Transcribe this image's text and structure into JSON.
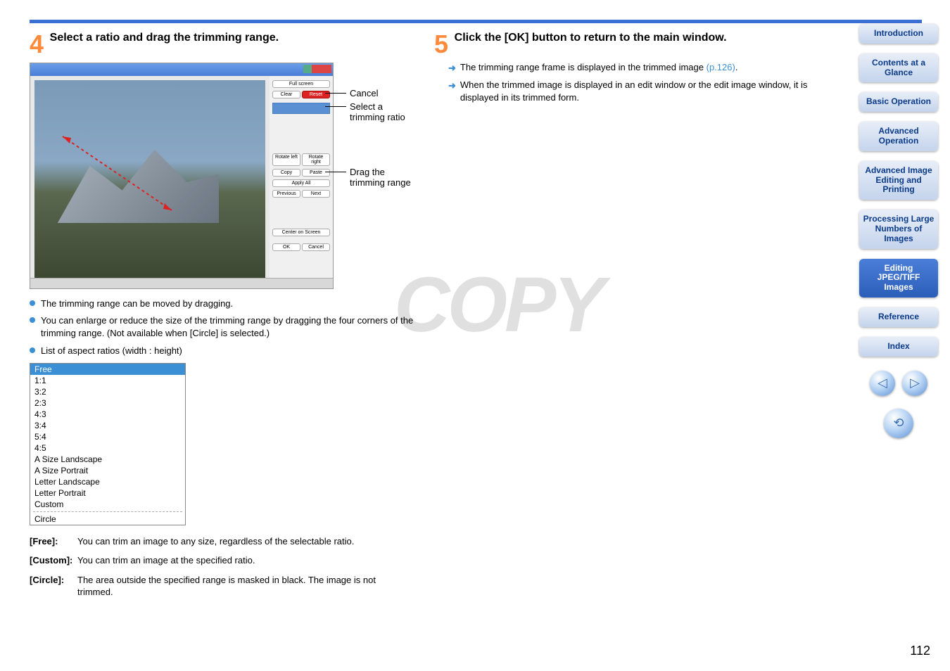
{
  "step4": {
    "num": "4",
    "title": "Select a ratio and drag the trimming range.",
    "callout_cancel": "Cancel",
    "callout_select": "Select a trimming ratio",
    "callout_drag": "Drag the trimming range",
    "b1": "The trimming range can be moved by dragging.",
    "b2": "You can enlarge or reduce the size of the trimming range by dragging the four corners of the trimming range. (Not available when [Circle] is selected.)",
    "b3": "List of aspect ratios (width : height)",
    "btn_full": "Full screen",
    "btn_clear": "Clear",
    "btn_reset": "Reset",
    "btn_rl": "Rotate left",
    "btn_rr": "Rotate right",
    "btn_copy": "Copy",
    "btn_paste": "Paste",
    "btn_apply": "Apply All",
    "btn_prev": "Previous",
    "btn_next": "Next",
    "btn_center": "Center on Screen",
    "btn_ok": "OK",
    "btn_cancel": "Cancel",
    "ratios": {
      "r0": "Free",
      "r1": "1:1",
      "r2": "3:2",
      "r3": "2:3",
      "r4": "4:3",
      "r5": "3:4",
      "r6": "5:4",
      "r7": "4:5",
      "r8": "A Size Landscape",
      "r9": "A Size Portrait",
      "r10": "Letter Landscape",
      "r11": "Letter Portrait",
      "r12": "Custom",
      "r13": "Circle"
    },
    "def_free_l": "[Free]:",
    "def_free_b": "You can trim an image to any size, regardless of the selectable ratio.",
    "def_custom_l": "[Custom]:",
    "def_custom_b": "You can trim an image at the specified ratio.",
    "def_circle_l": "[Circle]:",
    "def_circle_b": "The area outside the specified range is masked in black. The image is not trimmed."
  },
  "step5": {
    "num": "5",
    "title": "Click the [OK] button to return to the main window.",
    "b1a": "The trimming range frame is displayed in the trimmed image ",
    "b1b": "(p.126)",
    "b1c": ".",
    "b2": "When the trimmed image is displayed in an edit window or the edit image window, it is displayed in its trimmed form."
  },
  "nav": {
    "intro": "Introduction",
    "contents": "Contents at a Glance",
    "basic": "Basic Operation",
    "adv": "Advanced Operation",
    "adv2": "Advanced Image Editing and Printing",
    "proc": "Processing Large Numbers of Images",
    "edit": "Editing JPEG/TIFF Images",
    "ref": "Reference",
    "index": "Index"
  },
  "watermark": "COPY",
  "pagenum": "112"
}
